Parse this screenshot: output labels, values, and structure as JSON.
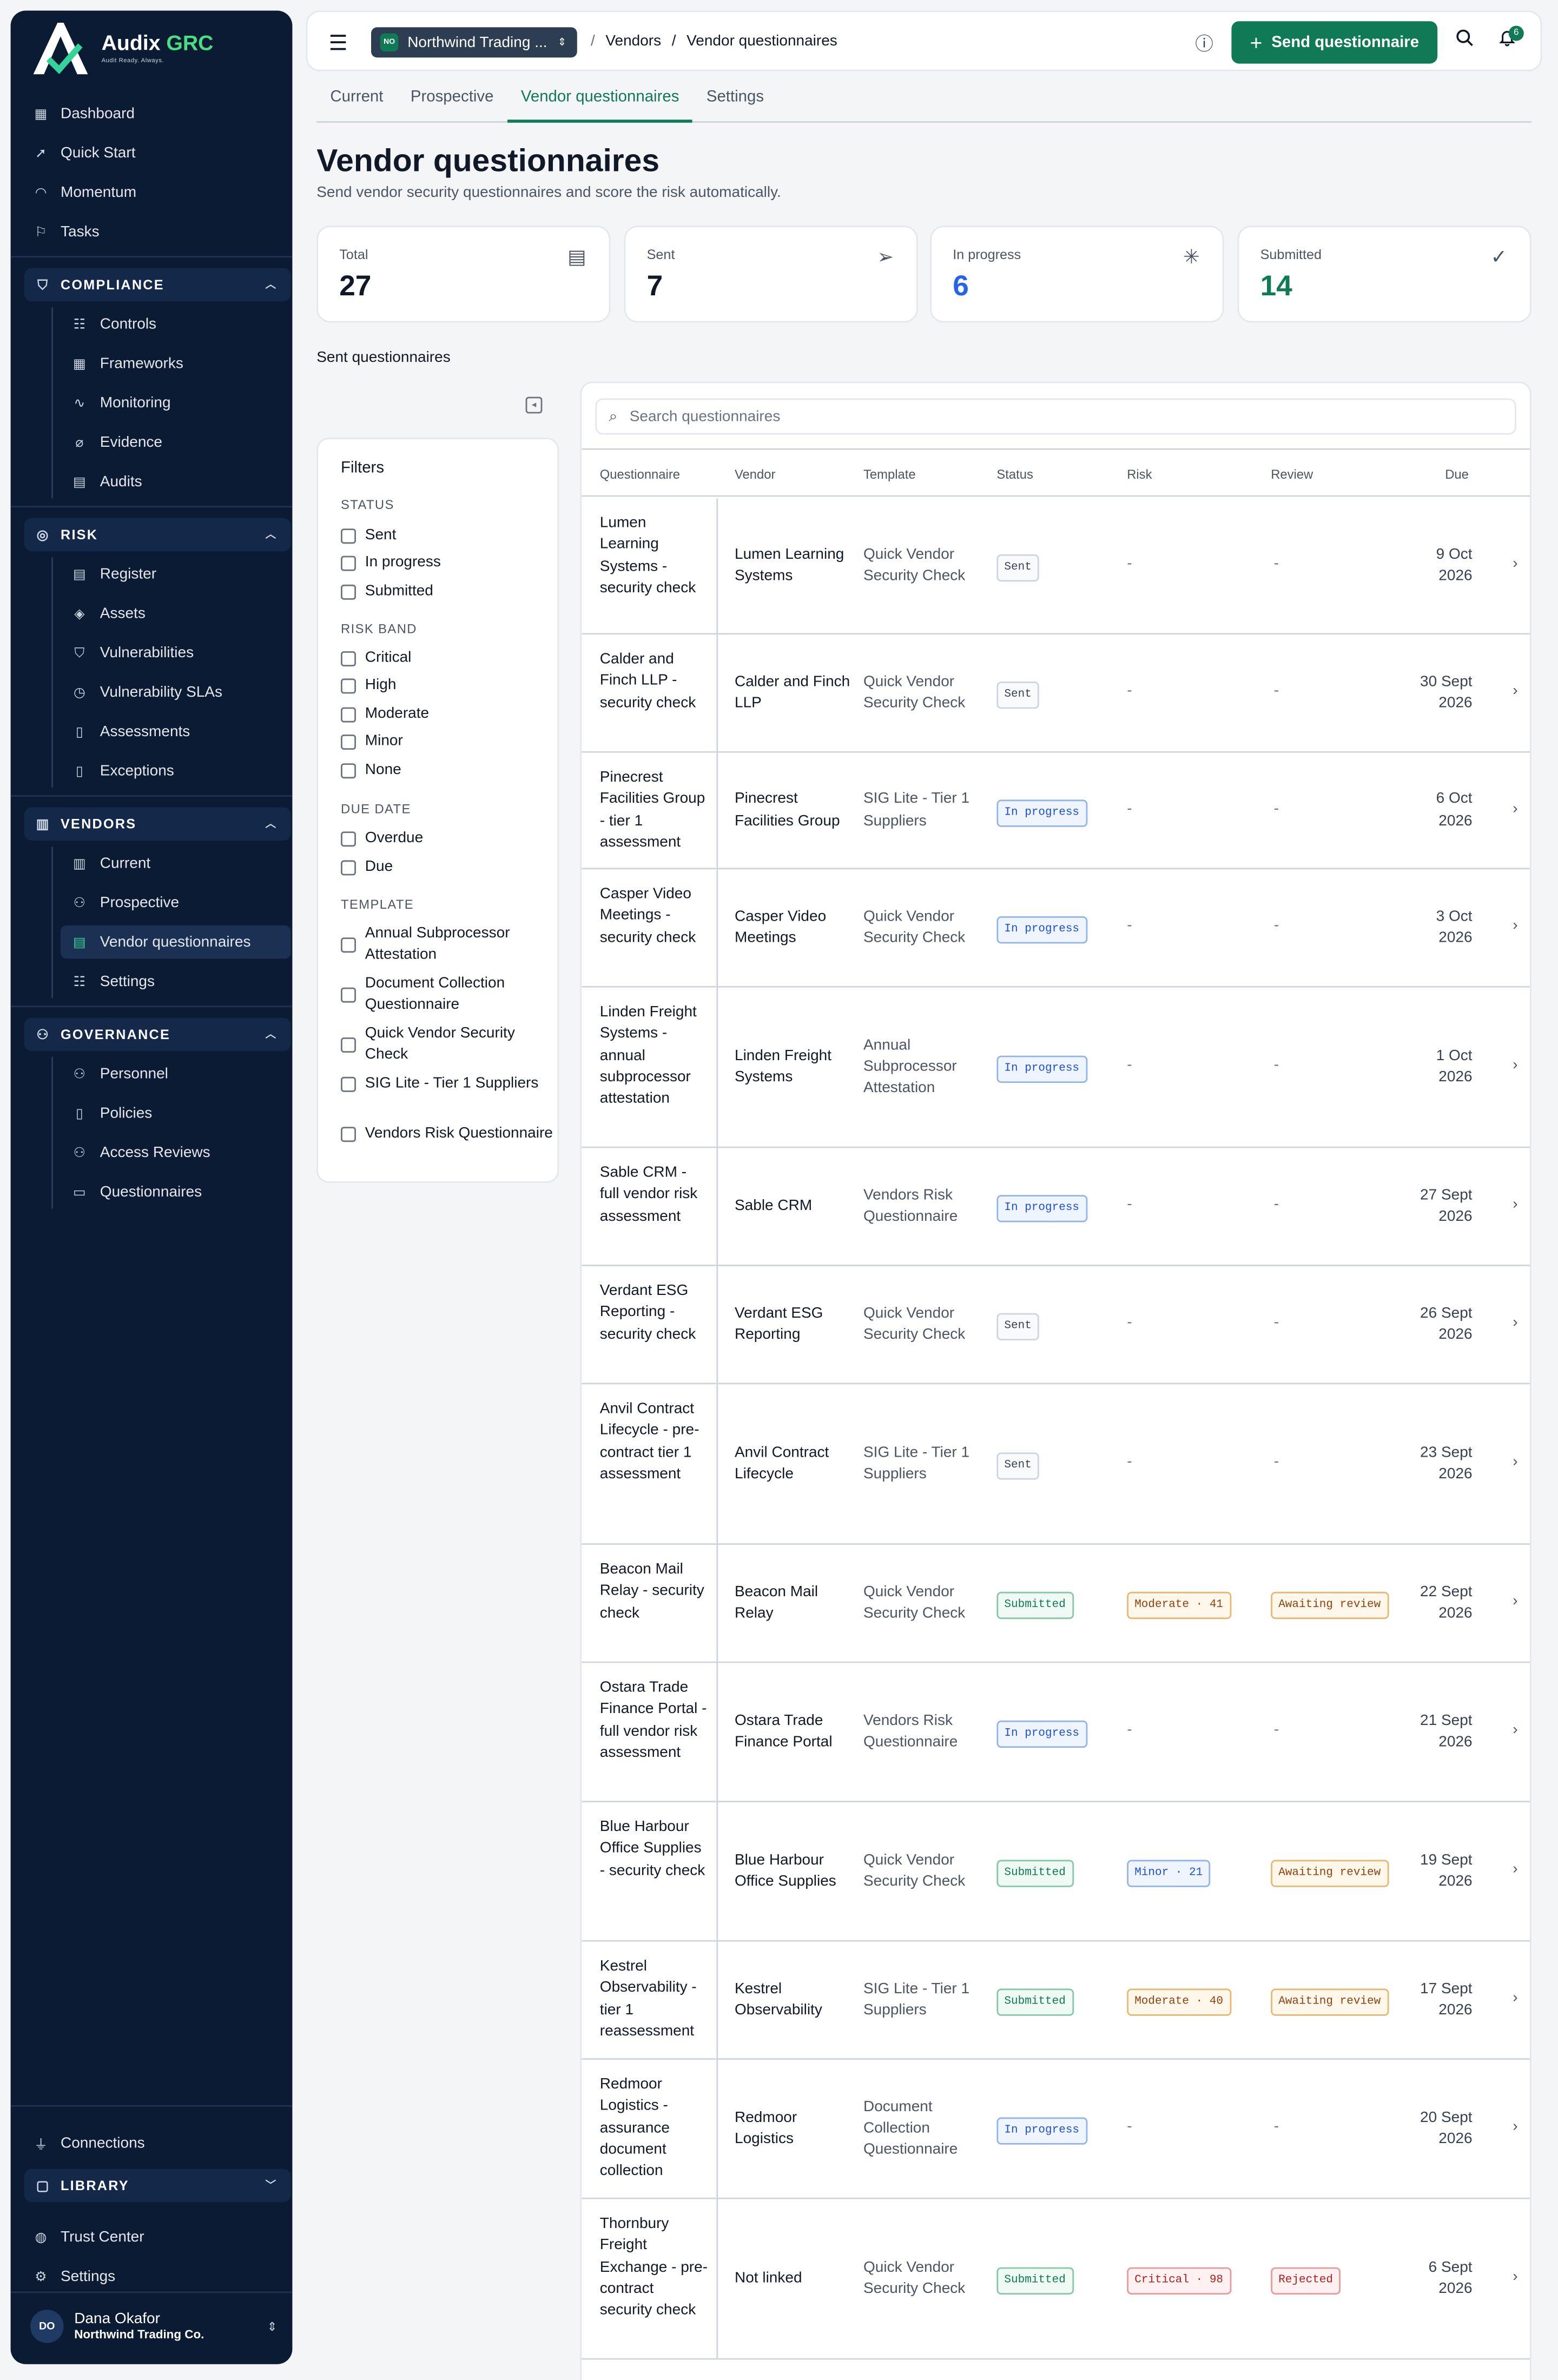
{
  "app": {
    "name": "Audix",
    "name_accent": "GRC",
    "tagline": "Audit Ready. Always."
  },
  "nav": {
    "dashboard": "Dashboard",
    "quick_start": "Quick Start",
    "momentum": "Momentum",
    "tasks": "Tasks"
  },
  "sections": {
    "compliance": {
      "title": "COMPLIANCE",
      "items": [
        "Controls",
        "Frameworks",
        "Monitoring",
        "Evidence",
        "Audits"
      ]
    },
    "risk": {
      "title": "RISK",
      "items": [
        "Register",
        "Assets",
        "Vulnerabilities",
        "Vulnerability SLAs",
        "Assessments",
        "Exceptions"
      ]
    },
    "vendors": {
      "title": "VENDORS",
      "items": [
        "Current",
        "Prospective",
        "Vendor questionnaires",
        "Settings"
      ]
    },
    "governance": {
      "title": "GOVERNANCE",
      "items": [
        "Personnel",
        "Policies",
        "Access Reviews",
        "Questionnaires"
      ]
    },
    "library": {
      "title": "LIBRARY"
    }
  },
  "bottom_nav": {
    "connections": "Connections",
    "trust_center": "Trust Center",
    "settings": "Settings"
  },
  "user": {
    "initials": "DO",
    "name": "Dana Okafor",
    "org": "Northwind Trading Co."
  },
  "topbar": {
    "org_initials": "NO",
    "org_name": "Northwind Trading ...",
    "breadcrumb": [
      "Vendors",
      "Vendor questionnaires"
    ],
    "send_label": "Send questionnaire",
    "notif_count": "6"
  },
  "tabs": [
    "Current",
    "Prospective",
    "Vendor questionnaires",
    "Settings"
  ],
  "page": {
    "title": "Vendor questionnaires",
    "subtitle": "Send vendor security questionnaires and score the risk automatically.",
    "section": "Sent questionnaires"
  },
  "stats": [
    {
      "label": "Total",
      "value": "27",
      "color": "#111827"
    },
    {
      "label": "Sent",
      "value": "7",
      "color": "#111827"
    },
    {
      "label": "In progress",
      "value": "6",
      "color": "#2563eb"
    },
    {
      "label": "Submitted",
      "value": "14",
      "color": "#0f7a55"
    }
  ],
  "filters": {
    "title": "Filters",
    "status": {
      "title": "STATUS",
      "options": [
        "Sent",
        "In progress",
        "Submitted"
      ]
    },
    "risk_band": {
      "title": "RISK BAND",
      "options": [
        "Critical",
        "High",
        "Moderate",
        "Minor",
        "None"
      ]
    },
    "due_date": {
      "title": "DUE DATE",
      "options": [
        "Overdue",
        "Due"
      ]
    },
    "template": {
      "title": "TEMPLATE",
      "options": [
        "Annual Subprocessor Attestation",
        "Document Collection Questionnaire",
        "Quick Vendor Security Check",
        "SIG Lite - Tier 1 Suppliers",
        "Vendors Risk Questionnaire"
      ]
    }
  },
  "table": {
    "search_placeholder": "Search questionnaires",
    "columns": [
      "Questionnaire",
      "Vendor",
      "Template",
      "Status",
      "Risk",
      "Review",
      "Due"
    ],
    "rows": [
      {
        "q": "Lumen Learning Systems - security check",
        "vendor": "Lumen Learning Systems",
        "template": "Quick Vendor Security Check",
        "status": "Sent",
        "risk": "-",
        "review": "-",
        "due": "9 Oct 2026"
      },
      {
        "q": "Calder and Finch LLP - security check",
        "vendor": "Calder and Finch LLP",
        "template": "Quick Vendor Security Check",
        "status": "Sent",
        "risk": "-",
        "review": "-",
        "due": "30 Sept 2026"
      },
      {
        "q": "Pinecrest Facilities Group - tier 1 assessment",
        "vendor": "Pinecrest Facilities Group",
        "template": "SIG Lite - Tier 1 Suppliers",
        "status": "In progress",
        "risk": "-",
        "review": "-",
        "due": "6 Oct 2026"
      },
      {
        "q": "Casper Video Meetings - security check",
        "vendor": "Casper Video Meetings",
        "template": "Quick Vendor Security Check",
        "status": "In progress",
        "risk": "-",
        "review": "-",
        "due": "3 Oct 2026"
      },
      {
        "q": "Linden Freight Systems - annual subprocessor attestation",
        "vendor": "Linden Freight Systems",
        "template": "Annual Subprocessor Attestation",
        "status": "In progress",
        "risk": "-",
        "review": "-",
        "due": "1 Oct 2026"
      },
      {
        "q": "Sable CRM - full vendor risk assessment",
        "vendor": "Sable CRM",
        "template": "Vendors Risk Questionnaire",
        "status": "In progress",
        "risk": "-",
        "review": "-",
        "due": "27 Sept 2026"
      },
      {
        "q": "Verdant ESG Reporting - security check",
        "vendor": "Verdant ESG Reporting",
        "template": "Quick Vendor Security Check",
        "status": "Sent",
        "risk": "-",
        "review": "-",
        "due": "26 Sept 2026"
      },
      {
        "q": "Anvil Contract Lifecycle - pre-contract tier 1 assessment",
        "vendor": "Anvil Contract Lifecycle",
        "template": "SIG Lite - Tier 1 Suppliers",
        "status": "Sent",
        "risk": "-",
        "review": "-",
        "due": "23 Sept 2026"
      },
      {
        "q": "Beacon Mail Relay - security check",
        "vendor": "Beacon Mail Relay",
        "template": "Quick Vendor Security Check",
        "status": "Submitted",
        "risk": "Moderate · 41",
        "review": "Awaiting review",
        "due": "22 Sept 2026"
      },
      {
        "q": "Ostara Trade Finance Portal - full vendor risk assessment",
        "vendor": "Ostara Trade Finance Portal",
        "template": "Vendors Risk Questionnaire",
        "status": "In progress",
        "risk": "-",
        "review": "-",
        "due": "21 Sept 2026"
      },
      {
        "q": "Blue Harbour Office Supplies - security check",
        "vendor": "Blue Harbour Office Supplies",
        "template": "Quick Vendor Security Check",
        "status": "Submitted",
        "risk": "Minor · 21",
        "review": "Awaiting review",
        "due": "19 Sept 2026"
      },
      {
        "q": "Kestrel Observability - tier 1 reassessment",
        "vendor": "Kestrel Observability",
        "template": "SIG Lite - Tier 1 Suppliers",
        "status": "Submitted",
        "risk": "Moderate · 40",
        "review": "Awaiting review",
        "due": "17 Sept 2026"
      },
      {
        "q": "Redmoor Logistics - assurance document collection",
        "vendor": "Redmoor Logistics",
        "template": "Document Collection Questionnaire",
        "status": "In progress",
        "risk": "-",
        "review": "-",
        "due": "20 Sept 2026"
      },
      {
        "q": "Thornbury Freight Exchange - pre-contract security check",
        "vendor": "Not linked",
        "template": "Quick Vendor Security Check",
        "status": "Submitted",
        "risk": "Critical · 98",
        "review": "Rejected",
        "due": "6 Sept 2026"
      }
    ]
  }
}
